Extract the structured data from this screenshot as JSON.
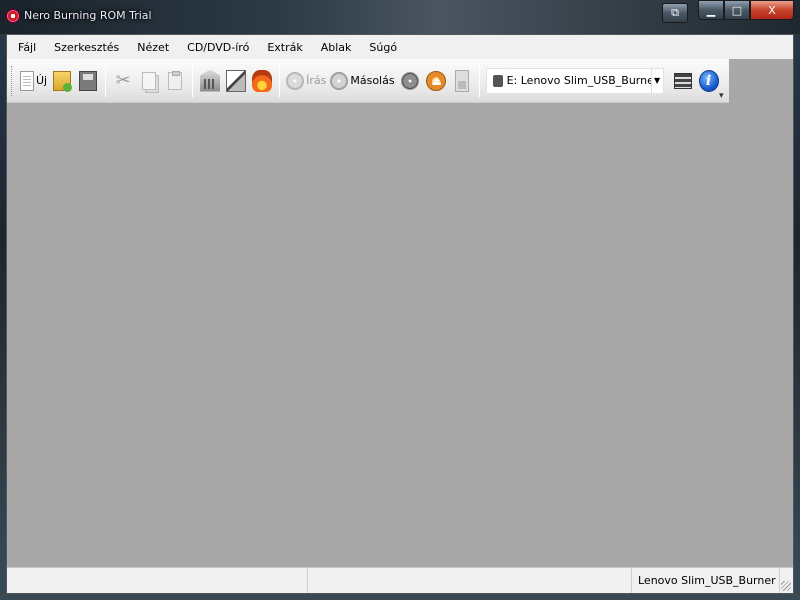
{
  "window": {
    "title": "Nero Burning ROM Trial",
    "buttons": {
      "minimize": "▁",
      "maximize": "□",
      "close": "X",
      "extra": "⧉"
    }
  },
  "menubar": {
    "items": [
      {
        "label": "Fájl"
      },
      {
        "label": "Szerkesztés"
      },
      {
        "label": "Nézet"
      },
      {
        "label": "CD/DVD-író"
      },
      {
        "label": "Extrák"
      },
      {
        "label": "Ablak"
      },
      {
        "label": "Súgó"
      }
    ]
  },
  "toolbar": {
    "new_label": "Új",
    "write_label": "Írás",
    "copy_label": "Másolás",
    "drive": {
      "selected": "E: Lenovo  Slim_USB_Burner",
      "arrow": "▼"
    },
    "overflow": "▾"
  },
  "statusbar": {
    "pane1": "",
    "pane2": "",
    "pane3": "Lenovo   Slim_USB_Burner"
  },
  "colors": {
    "workspace": "#a8a8a8",
    "menubar": "#f0f0f0",
    "close_button": "#c7432a"
  }
}
